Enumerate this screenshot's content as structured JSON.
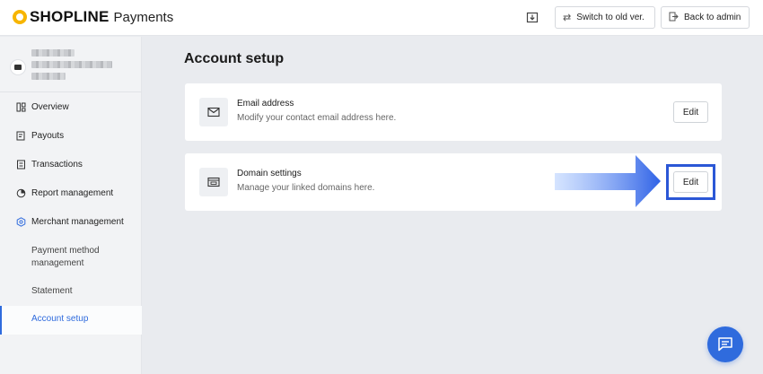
{
  "header": {
    "brand": "SHOPLINE",
    "product": "Payments",
    "switch_label": "Switch to old ver.",
    "admin_label": "Back to admin"
  },
  "sidebar": {
    "items": [
      {
        "label": "Overview",
        "icon": "overview-icon"
      },
      {
        "label": "Payouts",
        "icon": "payouts-icon"
      },
      {
        "label": "Transactions",
        "icon": "transactions-icon"
      },
      {
        "label": "Report management",
        "icon": "report-icon"
      },
      {
        "label": "Merchant management",
        "icon": "merchant-icon"
      }
    ],
    "sub_items": [
      {
        "label": "Payment method management"
      },
      {
        "label": "Statement"
      },
      {
        "label": "Account setup",
        "active": true
      }
    ]
  },
  "main": {
    "title": "Account setup",
    "cards": [
      {
        "title": "Email address",
        "description": "Modify your contact email address here.",
        "button": "Edit"
      },
      {
        "title": "Domain settings",
        "description": "Manage your linked domains here.",
        "button": "Edit"
      }
    ]
  },
  "colors": {
    "accent": "#2f6bdd",
    "highlight_box": "#2b57d6",
    "logo_mark": "#f7b500"
  }
}
